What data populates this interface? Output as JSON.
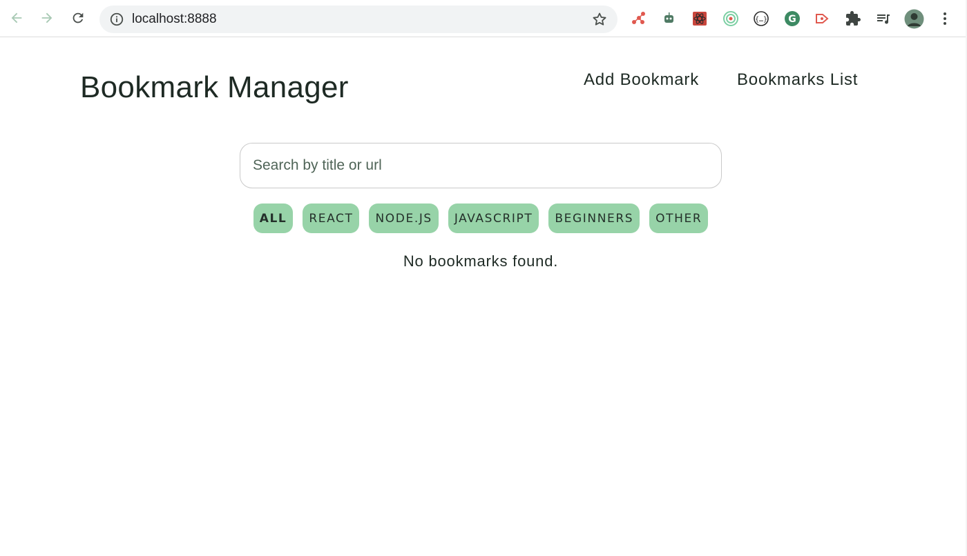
{
  "browser": {
    "url": "localhost:8888",
    "icons": {
      "back": "arrow-left-icon",
      "forward": "arrow-right-icon",
      "reload": "reload-icon",
      "info": "info-icon",
      "bookmark_star": "star-icon",
      "menu": "more-vert-icon"
    },
    "extensions": [
      "network-extension-icon",
      "robot-extension-icon",
      "react-devtools-icon",
      "target-extension-icon",
      "code-brackets-icon",
      "grammarly-icon",
      "redux-devtools-icon",
      "puzzle-icon",
      "playlist-icon",
      "profile-avatar"
    ]
  },
  "header": {
    "title": "Bookmark Manager",
    "nav": [
      {
        "label": "Add Bookmark"
      },
      {
        "label": "Bookmarks List"
      }
    ]
  },
  "search": {
    "placeholder": "Search by title or url",
    "value": ""
  },
  "filters": {
    "active": "ALL",
    "items": [
      {
        "label": "ALL"
      },
      {
        "label": "REACT"
      },
      {
        "label": "NODE.JS"
      },
      {
        "label": "JAVASCRIPT"
      },
      {
        "label": "BEGINNERS"
      },
      {
        "label": "OTHER"
      }
    ]
  },
  "results": {
    "empty_message": "No bookmarks found."
  },
  "colors": {
    "chip_bg": "#97d3a8",
    "text": "#1e2a24"
  }
}
